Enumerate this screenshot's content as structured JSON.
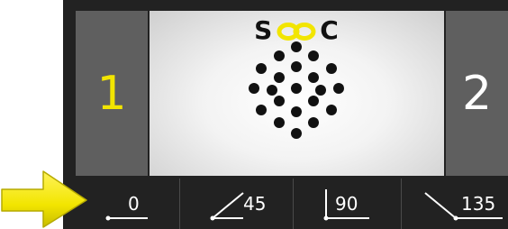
{
  "logo": {
    "left_letter": "S",
    "right_letter": "C",
    "link_color": "#f2e500"
  },
  "panels": {
    "left_number": "1",
    "right_number": "2"
  },
  "angles": [
    {
      "label": "0",
      "icon": "angle-0-icon"
    },
    {
      "label": "45",
      "icon": "angle-45-icon"
    },
    {
      "label": "90",
      "icon": "angle-90-icon"
    },
    {
      "label": "135",
      "icon": "angle-135-icon"
    }
  ],
  "pointer": {
    "icon": "yellow-arrow-icon",
    "color": "#f2e500"
  },
  "colors": {
    "accent_yellow": "#f2e500",
    "panel_gray": "#5f5f5f",
    "bar_dark": "#222222"
  }
}
